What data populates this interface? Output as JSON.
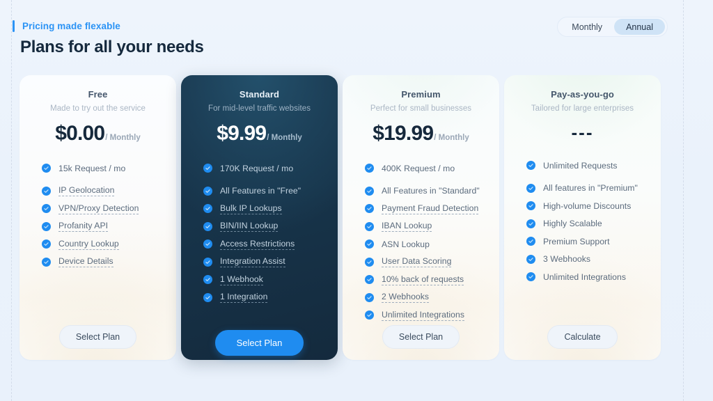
{
  "header": {
    "eyebrow": "Pricing made flexable",
    "title": "Plans for all your needs",
    "accent_color": "#2b93f5"
  },
  "billing_toggle": {
    "options": [
      {
        "label": "Monthly",
        "active": false
      },
      {
        "label": "Annual",
        "active": true
      }
    ],
    "active_bg": "#cfe3f6"
  },
  "plans": [
    {
      "name": "Free",
      "tagline": "Made to try out the service",
      "price": "$0.00",
      "period": "/ Monthly",
      "featured": false,
      "tint": "",
      "features": [
        {
          "label": "15k Request / mo",
          "hinted": false,
          "gap_after": true
        },
        {
          "label": "IP Geolocation",
          "hinted": true,
          "gap_after": false
        },
        {
          "label": "VPN/Proxy Detection",
          "hinted": true,
          "gap_after": false
        },
        {
          "label": "Profanity API",
          "hinted": true,
          "gap_after": false
        },
        {
          "label": "Country Lookup",
          "hinted": true,
          "gap_after": false
        },
        {
          "label": "Device Details",
          "hinted": true,
          "gap_after": false
        }
      ],
      "cta": {
        "label": "Select Plan",
        "primary": false
      }
    },
    {
      "name": "Standard",
      "tagline": "For mid-level traffic websites",
      "price": "$9.99",
      "period": "/ Monthly",
      "featured": true,
      "tint": "",
      "features": [
        {
          "label": "170K Request / mo",
          "hinted": false,
          "gap_after": true
        },
        {
          "label": "All Features in \"Free\"",
          "hinted": false,
          "gap_after": false
        },
        {
          "label": "Bulk IP Lookups",
          "hinted": true,
          "gap_after": false
        },
        {
          "label": "BIN/IIN Lookup",
          "hinted": true,
          "gap_after": false
        },
        {
          "label": "Access Restrictions",
          "hinted": true,
          "gap_after": false
        },
        {
          "label": "Integration Assist",
          "hinted": true,
          "gap_after": false
        },
        {
          "label": "1 Webhook",
          "hinted": true,
          "gap_after": false
        },
        {
          "label": "1 Integration",
          "hinted": true,
          "gap_after": false
        }
      ],
      "cta": {
        "label": "Select Plan",
        "primary": true
      }
    },
    {
      "name": "Premium",
      "tagline": "Perfect for small businesses",
      "price": "$19.99",
      "period": "/ Monthly",
      "featured": false,
      "tint": "tint-cool",
      "features": [
        {
          "label": "400K Request / mo",
          "hinted": false,
          "gap_after": true
        },
        {
          "label": "All Features in \"Standard\"",
          "hinted": false,
          "gap_after": false
        },
        {
          "label": "Payment Fraud Detection",
          "hinted": true,
          "gap_after": false
        },
        {
          "label": "IBAN Lookup",
          "hinted": true,
          "gap_after": false
        },
        {
          "label": "ASN Lookup",
          "hinted": false,
          "gap_after": false
        },
        {
          "label": "User Data Scoring",
          "hinted": true,
          "gap_after": false
        },
        {
          "label": "10% back of requests",
          "hinted": true,
          "gap_after": false
        },
        {
          "label": "2 Webhooks",
          "hinted": true,
          "gap_after": false
        },
        {
          "label": "Unlimited Integrations",
          "hinted": true,
          "gap_after": false
        }
      ],
      "cta": {
        "label": "Select Plan",
        "primary": false
      }
    },
    {
      "name": "Pay-as-you-go",
      "tagline": "Tailored for large enterprises",
      "price": "---",
      "period": "",
      "featured": false,
      "tint": "tint-green",
      "features": [
        {
          "label": "Unlimited Requests",
          "hinted": false,
          "gap_after": true
        },
        {
          "label": "All features in \"Premium\"",
          "hinted": false,
          "gap_after": false
        },
        {
          "label": "High-volume Discounts",
          "hinted": false,
          "gap_after": false
        },
        {
          "label": "Highly Scalable",
          "hinted": false,
          "gap_after": false
        },
        {
          "label": "Premium Support",
          "hinted": false,
          "gap_after": false
        },
        {
          "label": "3 Webhooks",
          "hinted": false,
          "gap_after": false
        },
        {
          "label": "Unlimited Integrations",
          "hinted": false,
          "gap_after": false
        }
      ],
      "cta": {
        "label": "Calculate",
        "primary": false
      }
    }
  ]
}
